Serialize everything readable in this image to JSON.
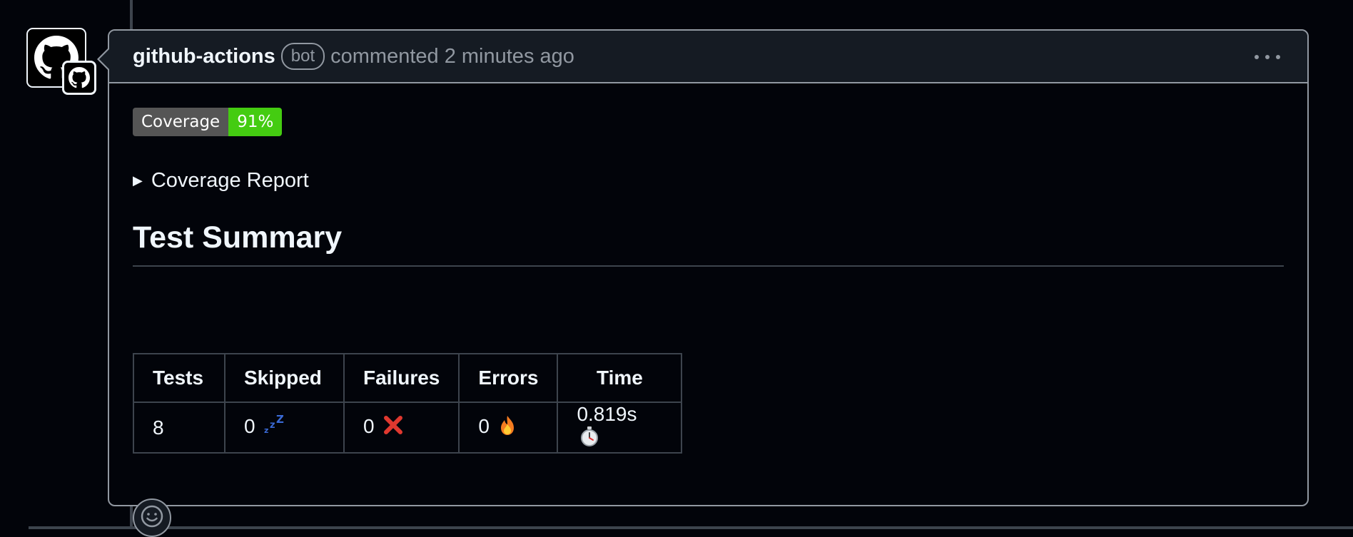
{
  "comment": {
    "author": "github-actions",
    "bot_label": "bot",
    "meta": "commented 2 minutes ago"
  },
  "coverage_badge": {
    "label": "Coverage",
    "value": "91%",
    "label_color": "#555555",
    "value_color": "#44cc11"
  },
  "details": {
    "summary": "Coverage Report"
  },
  "test_summary": {
    "heading": "Test Summary",
    "columns": [
      "Tests",
      "Skipped",
      "Failures",
      "Errors",
      "Time"
    ],
    "values": {
      "tests": "8",
      "skipped": "0",
      "failures": "0",
      "errors": "0",
      "time": "0.819s"
    },
    "icons": {
      "skipped": "zzz-sleep-icon",
      "failures": "red-x-icon",
      "errors": "fire-icon",
      "time": "stopwatch-icon"
    }
  },
  "icons": {
    "avatar": "github-octocat-icon",
    "avatar_badge": "github-app-badge-icon",
    "more": "kebab-horizontal-icon",
    "reaction": "smiley-icon"
  },
  "colors": {
    "background": "#02040a",
    "header_bg": "#151b23",
    "border": "#9198a1",
    "text": "#f0f6fc",
    "muted": "#9198a1"
  }
}
